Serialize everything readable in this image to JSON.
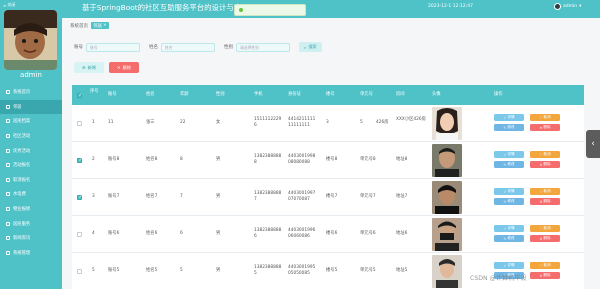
{
  "sidebar": {
    "toggle_label": "关闭",
    "admin_name": "admin",
    "items": [
      {
        "label": "系统首页",
        "active": false
      },
      {
        "label": "邻居",
        "active": true
      },
      {
        "label": "居民档案",
        "active": false
      },
      {
        "label": "社区活动",
        "active": false
      },
      {
        "label": "优秀活动",
        "active": false
      },
      {
        "label": "活动报名",
        "active": false
      },
      {
        "label": "取消报名",
        "active": false
      },
      {
        "label": "水电费",
        "active": false
      },
      {
        "label": "物业报修",
        "active": false
      },
      {
        "label": "居民服务",
        "active": false
      },
      {
        "label": "新闻资讯",
        "active": false
      },
      {
        "label": "系统管理",
        "active": false
      }
    ]
  },
  "topbar": {
    "title": "基于SpringBoot的社区互助服务平台的设计与实现",
    "toast": "",
    "datetime": "2023-12-1 12:12:47",
    "username": "admin"
  },
  "breadcrumb": {
    "home": "系统首页",
    "current": "邻居"
  },
  "search": {
    "labels": {
      "account": "账号",
      "name": "姓名",
      "gender": "性别"
    },
    "placeholders": {
      "account": "账号",
      "name": "姓名",
      "gender": "请选择性别"
    },
    "button": "搜索"
  },
  "actions": {
    "add": "新增",
    "delete": "删除"
  },
  "table": {
    "headers": [
      "序号",
      "账号",
      "姓名",
      "年龄",
      "性别",
      "手机",
      "身份证",
      "楼号",
      "单元号",
      "房间",
      "头像",
      "操作"
    ],
    "rows": [
      {
        "index": "1",
        "account": "11",
        "name": "张三",
        "age": "22",
        "gender": "女",
        "phone": "15111122296",
        "id_card": "441421111111111111",
        "building": "3",
        "unit": "5",
        "room": "426房",
        "extra": "XXX小区426房",
        "checked": false
      },
      {
        "index": "2",
        "account": "账号8",
        "name": "姓名8",
        "age": "8",
        "gender": "男",
        "phone": "13823888888",
        "id_card": "440300199808080088",
        "building": "楼号8",
        "unit": "单元号8",
        "room": "地址8",
        "extra": "",
        "checked": true
      },
      {
        "index": "3",
        "account": "账号7",
        "name": "姓名7",
        "age": "7",
        "gender": "男",
        "phone": "13823888887",
        "id_card": "440300199707070087",
        "building": "楼号7",
        "unit": "单元号7",
        "room": "地址7",
        "extra": "",
        "checked": true
      },
      {
        "index": "4",
        "account": "账号6",
        "name": "姓名6",
        "age": "6",
        "gender": "男",
        "phone": "13823888886",
        "id_card": "440300199606060086",
        "building": "楼号6",
        "unit": "单元号6",
        "room": "地址6",
        "extra": "",
        "checked": false
      },
      {
        "index": "5",
        "account": "账号5",
        "name": "姓名5",
        "age": "5",
        "gender": "男",
        "phone": "13823888885",
        "id_card": "440300199505050085",
        "building": "楼号5",
        "unit": "单元号5",
        "room": "地址5",
        "extra": "",
        "checked": false
      }
    ],
    "op_labels": {
      "detail": "详情",
      "edit": "修改",
      "cancel": "取消",
      "delete": "删除"
    }
  },
  "watermark": "CSDN @计算机毕设",
  "colors": {
    "accent": "#4fc2c8",
    "accent_dark": "#3aa7ae",
    "danger": "#f56c6c",
    "warning": "#f3a63b",
    "info": "#7bc8ea"
  }
}
